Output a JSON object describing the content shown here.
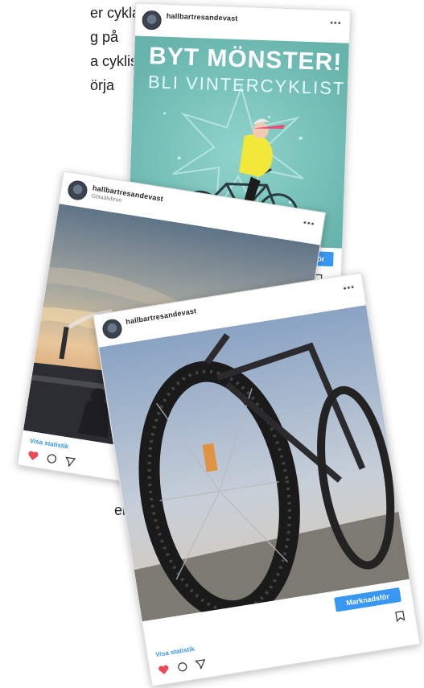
{
  "document": {
    "lines": [
      "er cykla",
      "g på",
      "a cyklister",
      "örja"
    ],
    "bottom_line": "emsida"
  },
  "posts": [
    {
      "username": "hallbartresandevast",
      "menu": "•••",
      "headline": "BYT MÖNSTER!",
      "subheadline": "BLI VINTERCYKLIST",
      "promote_label": "Marknadsför"
    },
    {
      "username": "hallbartresandevast",
      "location": "Götaälvbron",
      "menu": "•••",
      "stats_label": "Visa statistik"
    },
    {
      "username": "hallbartresandevast",
      "menu": "•••",
      "promote_label": "Marknadsför",
      "stats_label": "Visa statistik"
    }
  ],
  "colors": {
    "accent": "#3897f0",
    "heart": "#ed4956",
    "poster_bg": "#7fc8c0",
    "jacket": "#f2e83a"
  },
  "icons": [
    "heart-icon",
    "comment-icon",
    "share-icon",
    "bookmark-icon",
    "more-icon"
  ]
}
